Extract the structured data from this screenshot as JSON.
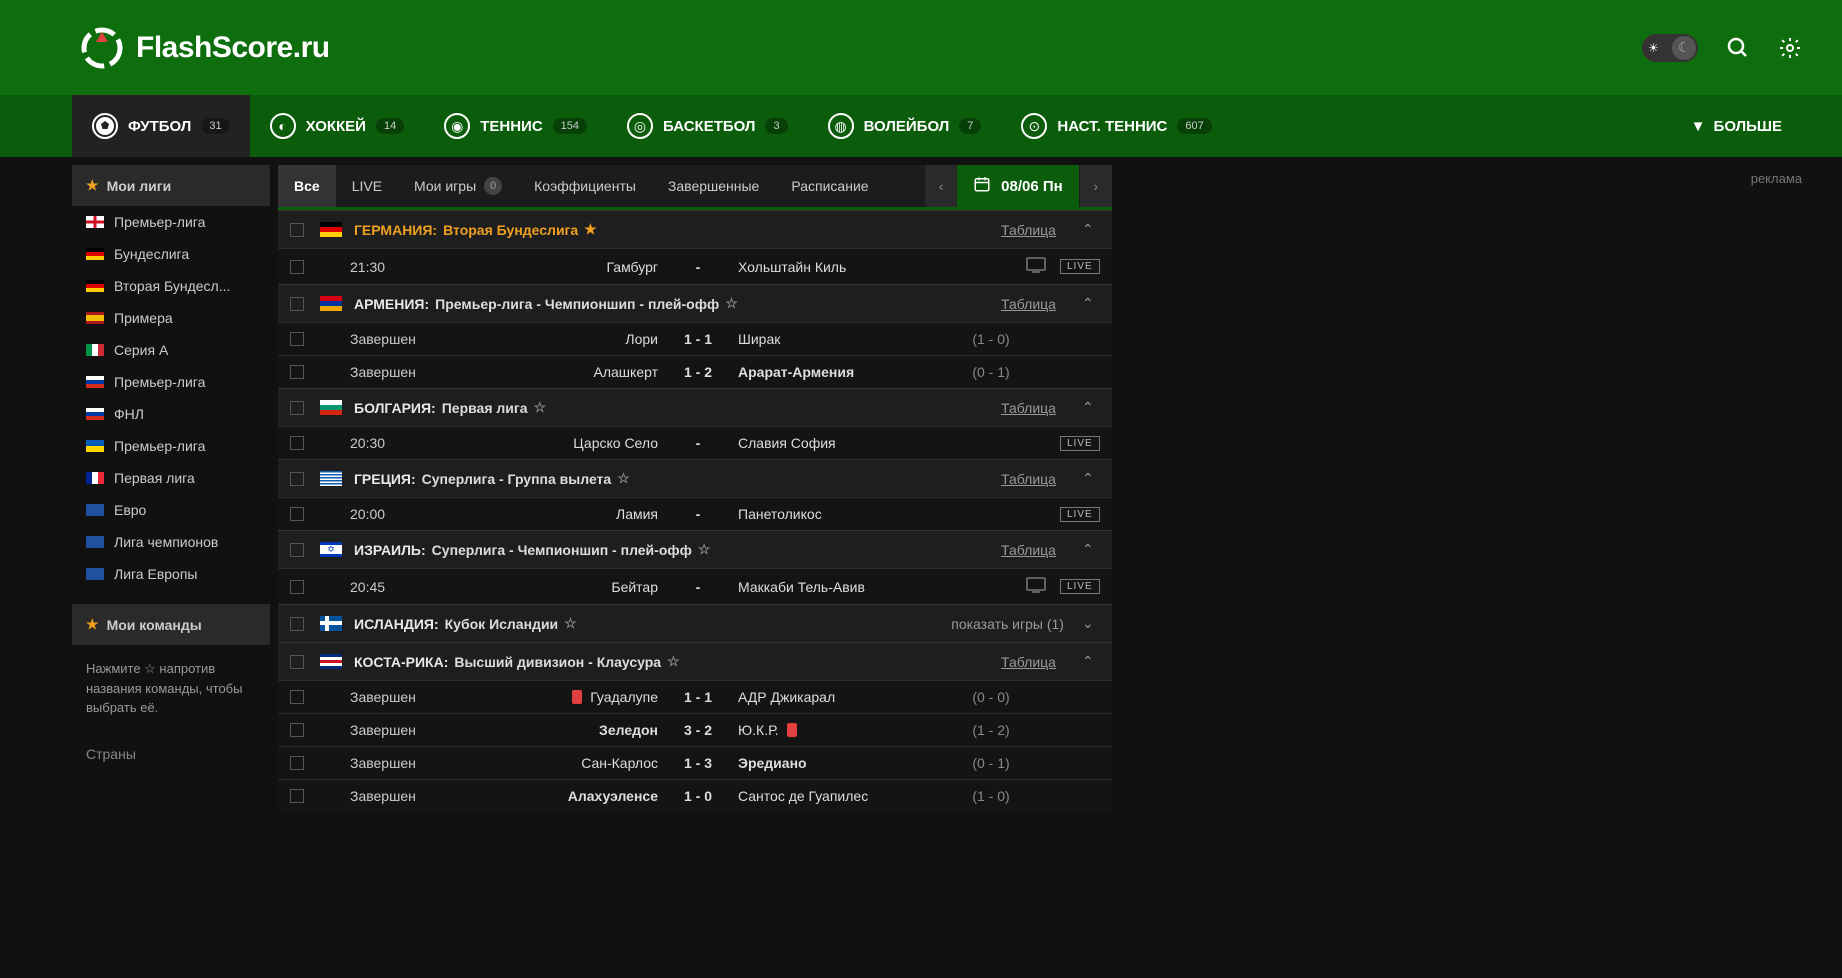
{
  "site_name": "FlashScore.ru",
  "header": {
    "search_label": "Поиск",
    "settings_label": "Настройки"
  },
  "sports": [
    {
      "name": "ФУТБОЛ",
      "count": "31",
      "active": true
    },
    {
      "name": "ХОККЕЙ",
      "count": "14"
    },
    {
      "name": "ТЕННИС",
      "count": "154"
    },
    {
      "name": "БАСКЕТБОЛ",
      "count": "3"
    },
    {
      "name": "ВОЛЕЙБОЛ",
      "count": "7"
    },
    {
      "name": "НАСТ. ТЕННИС",
      "count": "607"
    }
  ],
  "more_label": "БОЛЬШЕ",
  "sidebar": {
    "my_leagues": "Мои лиги",
    "leagues": [
      {
        "flag": "f-eng",
        "name": "Премьер-лига"
      },
      {
        "flag": "f-ger",
        "name": "Бундеслига"
      },
      {
        "flag": "f-ger",
        "name": "Вторая Бундесл..."
      },
      {
        "flag": "f-esp",
        "name": "Примера"
      },
      {
        "flag": "f-ita",
        "name": "Серия А"
      },
      {
        "flag": "f-rus",
        "name": "Премьер-лига"
      },
      {
        "flag": "f-rus",
        "name": "ФНЛ"
      },
      {
        "flag": "f-ukr",
        "name": "Премьер-лига"
      },
      {
        "flag": "f-fra",
        "name": "Первая лига"
      },
      {
        "flag": "f-eu",
        "name": "Евро"
      },
      {
        "flag": "f-eu",
        "name": "Лига чемпионов"
      },
      {
        "flag": "f-eu",
        "name": "Лига Европы"
      }
    ],
    "my_teams": "Мои команды",
    "teams_tip": "Нажмите ☆ напротив названия команды, чтобы выбрать её.",
    "countries": "Страны"
  },
  "filters": {
    "tabs": [
      {
        "label": "Все",
        "active": true
      },
      {
        "label": "LIVE"
      },
      {
        "label": "Мои игры",
        "badge": "0"
      },
      {
        "label": "Коэффициенты"
      },
      {
        "label": "Завершенные"
      },
      {
        "label": "Расписание"
      }
    ],
    "date": "08/06 Пн"
  },
  "table_link": "Таблица",
  "competitions": [
    {
      "flag": "f-ger",
      "country": "ГЕРМАНИЯ:",
      "league": "Вторая Бундеслига",
      "star": "gold",
      "table": true,
      "matches": [
        {
          "time": "21:30",
          "home": "Гамбург",
          "score": "-",
          "away": "Хольштайн Киль",
          "tv": true,
          "live": true
        }
      ]
    },
    {
      "flag": "f-arm",
      "country": "АРМЕНИЯ:",
      "league": "Премьер-лига - Чемпионшип - плей-офф",
      "star": "grey",
      "table": true,
      "matches": [
        {
          "time": "Завершен",
          "home": "Лори",
          "score": "1 - 1",
          "away": "Ширак",
          "ht": "(1 - 0)"
        },
        {
          "time": "Завершен",
          "home": "Алашкерт",
          "score": "1 - 2",
          "away": "Арарат-Армения",
          "away_bold": true,
          "ht": "(0 - 1)"
        }
      ]
    },
    {
      "flag": "f-bul",
      "country": "БОЛГАРИЯ:",
      "league": "Первая лига",
      "star": "grey",
      "table": true,
      "matches": [
        {
          "time": "20:30",
          "home": "Царско Село",
          "score": "-",
          "away": "Славия София",
          "live": true
        }
      ]
    },
    {
      "flag": "f-gre",
      "country": "ГРЕЦИЯ:",
      "league": "Суперлига - Группа вылета",
      "star": "grey",
      "table": true,
      "matches": [
        {
          "time": "20:00",
          "home": "Ламия",
          "score": "-",
          "away": "Панетоликос",
          "live": true
        }
      ]
    },
    {
      "flag": "f-isr",
      "country": "ИЗРАИЛЬ:",
      "league": "Суперлига - Чемпионшип - плей-офф",
      "star": "grey",
      "table": true,
      "matches": [
        {
          "time": "20:45",
          "home": "Бейтар",
          "score": "-",
          "away": "Маккаби Тель-Авив",
          "tv": true,
          "live": true
        }
      ]
    },
    {
      "flag": "f-isl",
      "country": "ИСЛАНДИЯ:",
      "league": "Кубок Исландии",
      "star": "grey",
      "collapsed": true,
      "show_text": "показать игры (1)"
    },
    {
      "flag": "f-cri",
      "country": "КОСТА-РИКА:",
      "league": "Высший дивизион - Клаусура",
      "star": "grey",
      "table": true,
      "matches": [
        {
          "time": "Завершен",
          "home": "Гуадалупе",
          "home_red": true,
          "score": "1 - 1",
          "away": "АДР Джикарал",
          "ht": "(0 - 0)"
        },
        {
          "time": "Завершен",
          "home": "Зеледон",
          "home_bold": true,
          "score": "3 - 2",
          "away": "Ю.К.Р.",
          "away_red": true,
          "ht": "(1 - 2)"
        },
        {
          "time": "Завершен",
          "home": "Сан-Карлос",
          "score": "1 - 3",
          "away": "Эредиано",
          "away_bold": true,
          "ht": "(0 - 1)"
        },
        {
          "time": "Завершен",
          "home": "Алахуэленсе",
          "home_bold": true,
          "score": "1 - 0",
          "away": "Сантос де Гуапилес",
          "ht": "(1 - 0)"
        }
      ]
    }
  ],
  "ad_label": "реклама"
}
